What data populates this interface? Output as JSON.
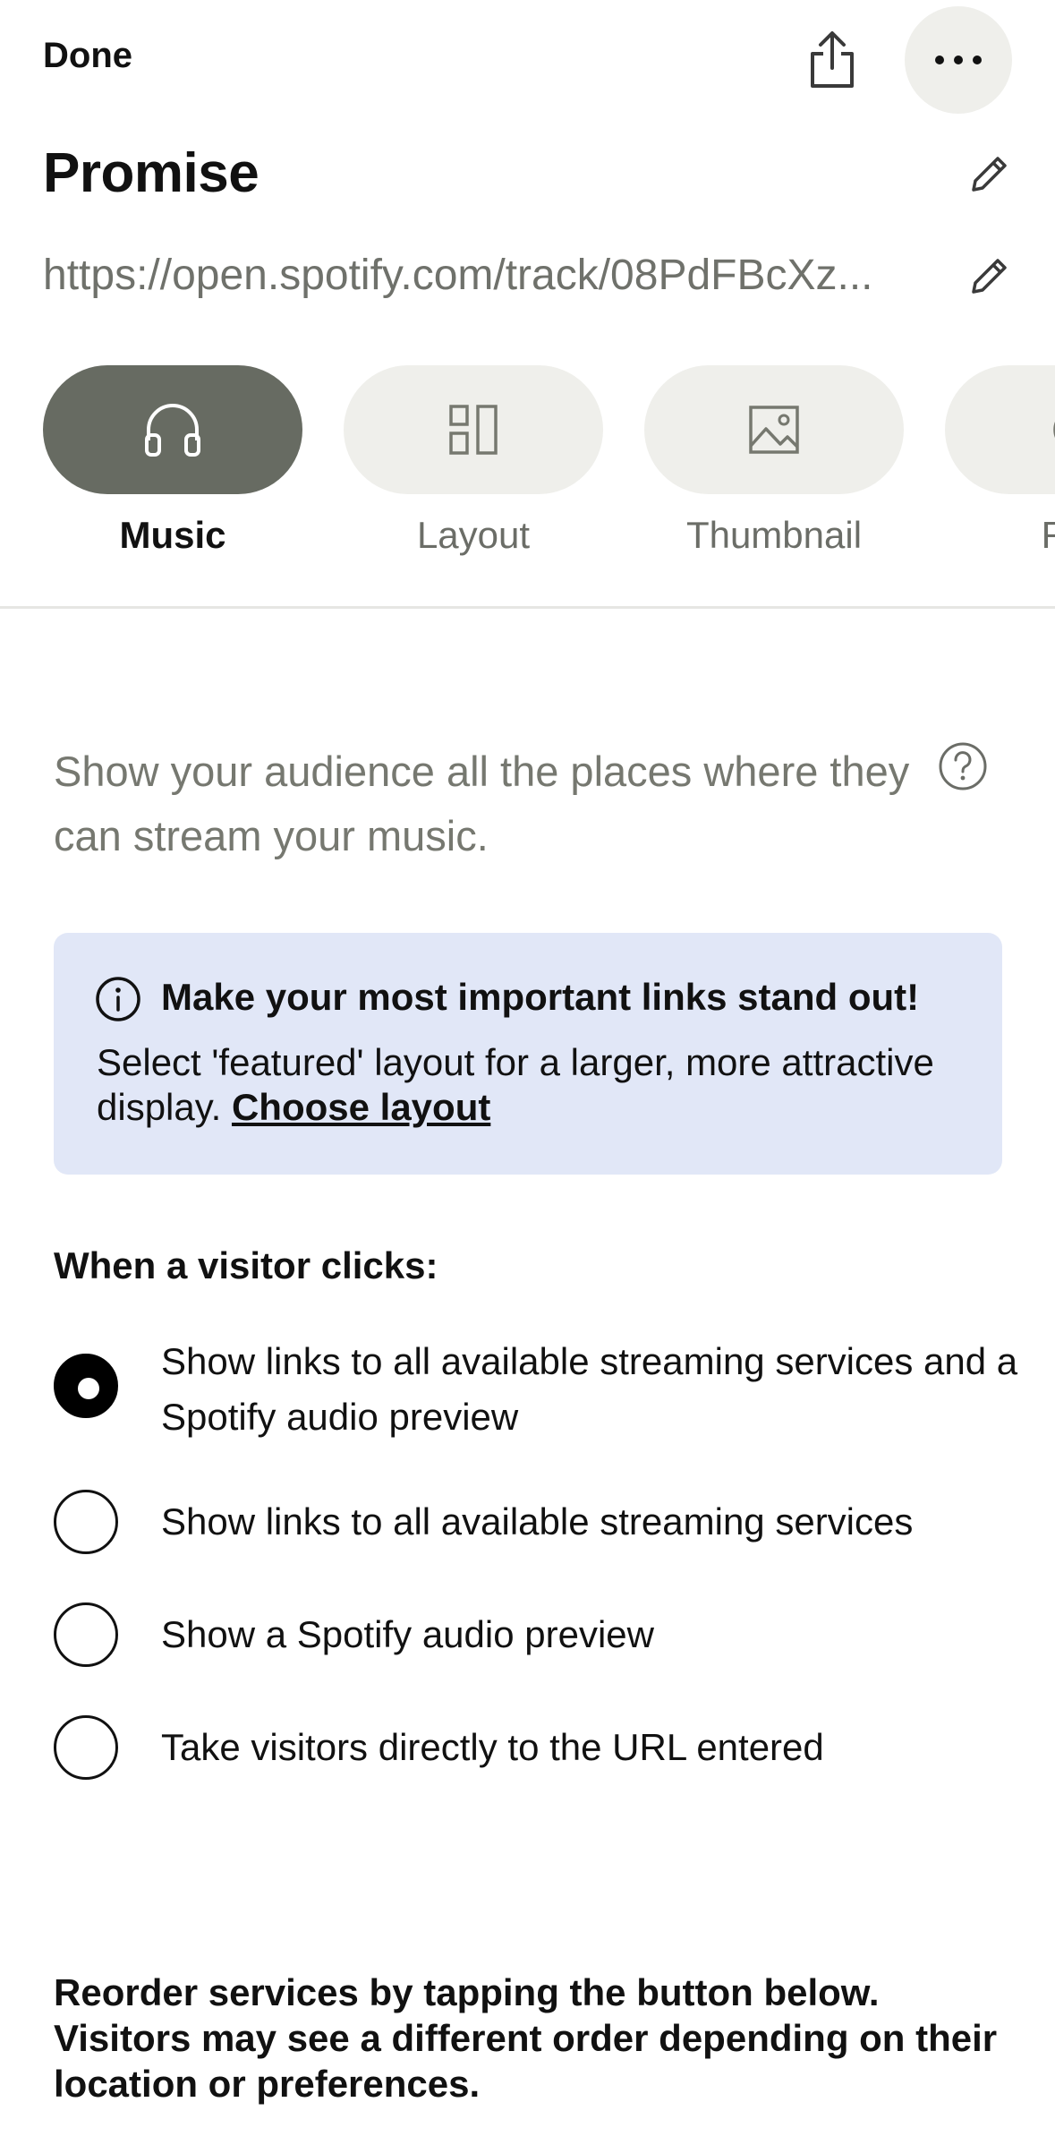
{
  "header": {
    "done_label": "Done",
    "share_icon": "share-icon",
    "more_icon": "more-icon"
  },
  "item": {
    "title": "Promise",
    "url": "https://open.spotify.com/track/08PdFBcXz..."
  },
  "tabs": [
    {
      "label": "Music",
      "icon": "headphones-icon",
      "active": true
    },
    {
      "label": "Layout",
      "icon": "layout-icon",
      "active": false
    },
    {
      "label": "Thumbnail",
      "icon": "image-icon",
      "active": false
    },
    {
      "label": "Rec",
      "icon": "unknown-icon",
      "active": false
    }
  ],
  "intro_text": "Show your audience all the places where they can stream your music.",
  "notice": {
    "title": "Make your most important links stand out!",
    "body": "Select 'featured' layout for a larger, more attractive display.",
    "link": "Choose layout"
  },
  "click_section": {
    "label": "When a visitor clicks:",
    "options": [
      {
        "text": "Show links to all available streaming services and a Spotify audio preview",
        "selected": true
      },
      {
        "text": "Show links to all available streaming services",
        "selected": false
      },
      {
        "text": "Show a Spotify audio preview",
        "selected": false
      },
      {
        "text": "Take visitors directly to the URL entered",
        "selected": false
      }
    ]
  },
  "reorder_note": "Reorder services by tapping the button below. Visitors may see a different order depending on their location or preferences.",
  "colors": {
    "active_tab": "#676b62",
    "inactive_tab": "#efefeb",
    "notice_bg": "#e1e7f7",
    "muted_text": "#767870"
  }
}
